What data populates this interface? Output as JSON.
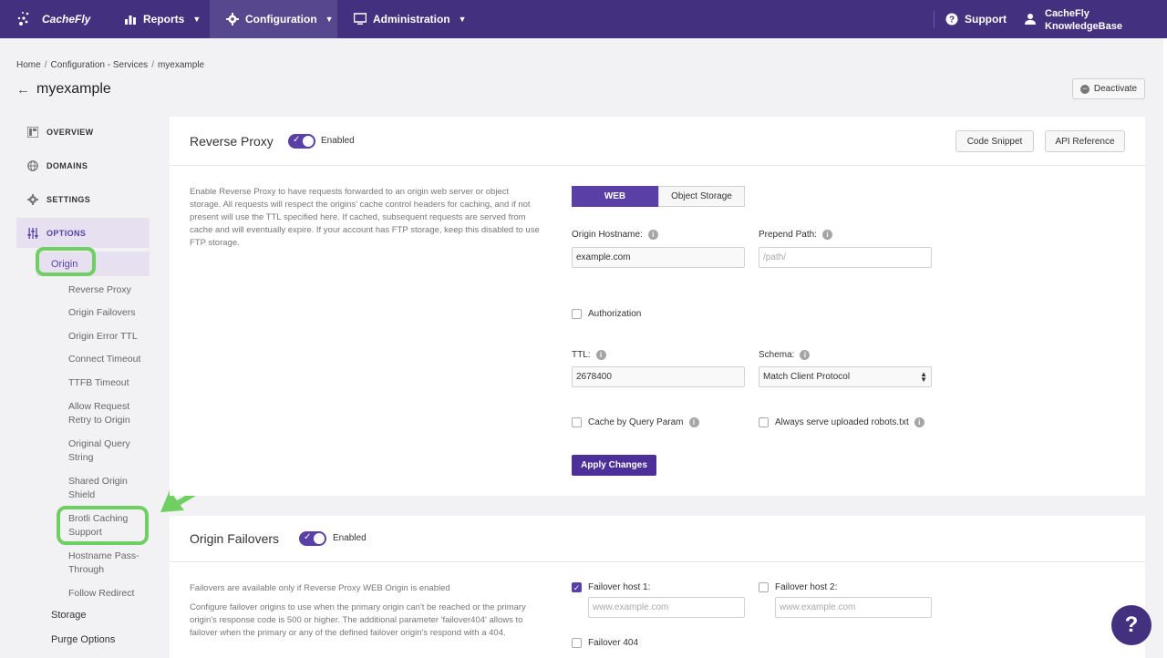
{
  "nav": {
    "logo": "CacheFly",
    "reports": "Reports",
    "configuration": "Configuration",
    "administration": "Administration",
    "support": "Support",
    "account_line1": "CacheFly",
    "account_line2": "KnowledgeBase"
  },
  "breadcrumb": [
    "Home",
    "Configuration - Services",
    "myexample"
  ],
  "page_title": "myexample",
  "deactivate": "Deactivate",
  "sidebar": {
    "overview": "OVERVIEW",
    "domains": "DOMAINS",
    "settings": "SETTINGS",
    "options": "OPTIONS",
    "origin": "Origin",
    "sub_items": [
      "Reverse Proxy",
      "Origin Failovers",
      "Origin Error TTL",
      "Connect Timeout",
      "TTFB Timeout",
      "Allow Request Retry to Origin",
      "Original Query String",
      "Shared Origin Shield",
      "Brotli Caching Support",
      "Hostname Pass-Through",
      "Follow Redirect"
    ],
    "storage": "Storage",
    "purge": "Purge Options"
  },
  "reverse_proxy": {
    "title": "Reverse Proxy",
    "toggle_label": "Enabled",
    "code_snippet": "Code Snippet",
    "api_reference": "API Reference",
    "description": "Enable Reverse Proxy to have requests forwarded to an origin web server or object storage. All requests will respect the origins' cache control headers for caching, and if not present will use the TTL specified here. If cached, subsequent requests are served from cache and will eventually expire. If your account has FTP storage, keep this disabled to use FTP storage.",
    "tab_web": "WEB",
    "tab_object_storage": "Object Storage",
    "origin_hostname_label": "Origin Hostname:",
    "origin_hostname_value": "example.com",
    "prepend_path_label": "Prepend Path:",
    "prepend_path_placeholder": "/path/",
    "authorization": "Authorization",
    "ttl_label": "TTL:",
    "ttl_value": "2678400",
    "schema_label": "Schema:",
    "schema_value": "Match Client Protocol",
    "cache_by_query": "Cache by Query Param",
    "robots": "Always serve uploaded robots.txt",
    "apply": "Apply Changes"
  },
  "origin_failovers": {
    "title": "Origin Failovers",
    "toggle_label": "Enabled",
    "note": "Failovers are available only if Reverse Proxy WEB Origin is enabled",
    "description": "Configure failover origins to use when the primary origin can't be reached or the primary origin's response code is 500 or higher. The additional parameter 'failover404' allows to failover when the primary or any of the defined failover origin's respond with a 404.",
    "host1_label": "Failover host 1:",
    "host1_placeholder": "www.example.com",
    "host2_label": "Failover host 2:",
    "host2_placeholder": "www.example.com",
    "failover404": "Failover 404"
  },
  "help_label": "?"
}
